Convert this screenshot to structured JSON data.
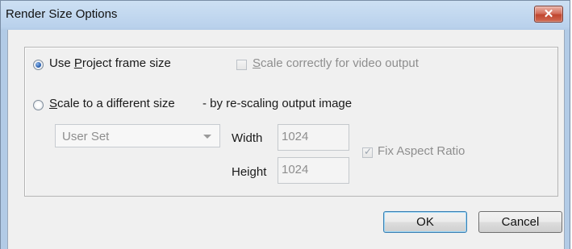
{
  "window": {
    "title": "Render Size Options",
    "close_glyph": "✕"
  },
  "options": {
    "use_project": {
      "prefix": "Use ",
      "underlined": "P",
      "rest": "roject frame size",
      "selected": true
    },
    "scale_correct": {
      "underlined": "S",
      "rest": "cale correctly for video output",
      "checked": false,
      "enabled": false
    },
    "scale_different": {
      "underlined": "S",
      "rest": "cale to a different size",
      "selected": false
    },
    "scale_note": "- by re-scaling output image"
  },
  "size": {
    "preset": "User Set",
    "width_label": "Width",
    "width_value": "1024",
    "height_label": "Height",
    "height_value": "1024",
    "fix_aspect_label": "Fix Aspect Ratio",
    "fix_aspect_checked": true
  },
  "buttons": {
    "ok": "OK",
    "cancel": "Cancel"
  }
}
